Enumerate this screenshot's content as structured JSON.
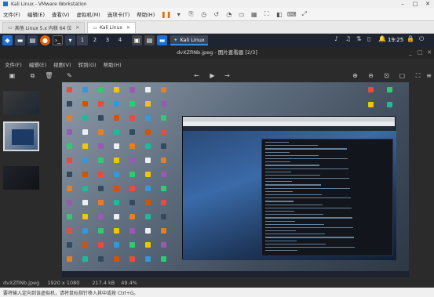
{
  "vmware": {
    "title": "Kali Linux - VMware Workstation",
    "menu": [
      "文件(F)",
      "编辑(E)",
      "查看(V)",
      "虚拟机(M)",
      "选项卡(T)",
      "帮助(H)"
    ],
    "tabs": [
      {
        "label": "其他 Linux 5.x 内核 64 位",
        "active": false
      },
      {
        "label": "Kali Linux",
        "active": true
      }
    ],
    "status_hint": "要将输入定向到该虚拟机，请将鼠标指针移入其中或按 Ctrl+G。"
  },
  "kali_panel": {
    "workspaces": [
      "1",
      "2",
      "3",
      "4"
    ],
    "active_workspace": "1",
    "task_label": "Kali Linux",
    "clock": "19:25"
  },
  "viewer": {
    "title": "dvXZfINb.jpeg - 图片查看器 [2/3]",
    "menu": [
      "文件(F)",
      "编辑(E)",
      "视图(V)",
      "转到(G)",
      "帮助(H)"
    ],
    "status": {
      "filename": "dvXZfINb.jpeg",
      "dimensions": "1920 x 1080",
      "size": "217.4 kB",
      "zoom": "49.4%"
    }
  },
  "icons": {
    "save": "save-icon",
    "copy": "copy-icon",
    "delete": "trash-icon",
    "edit": "edit-icon",
    "prev": "arrow-left-icon",
    "play": "play-icon",
    "next": "arrow-right-icon"
  }
}
